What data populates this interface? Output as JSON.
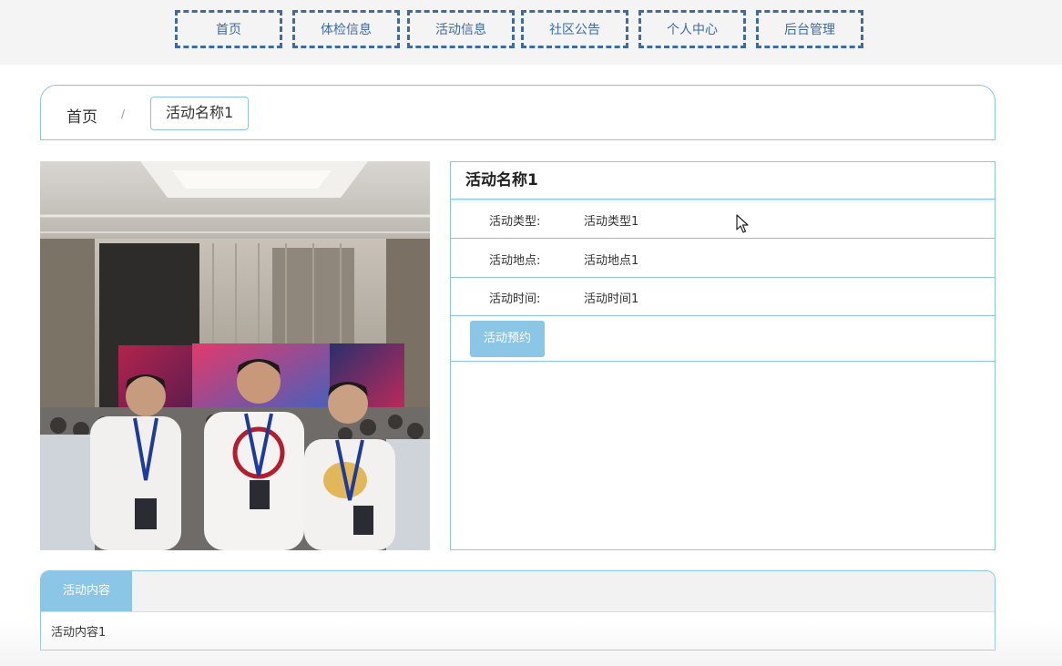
{
  "nav": {
    "items": [
      {
        "label": "首页"
      },
      {
        "label": "体检信息"
      },
      {
        "label": "活动信息"
      },
      {
        "label": "社区公告"
      },
      {
        "label": "个人中心"
      },
      {
        "label": "后台管理"
      }
    ]
  },
  "breadcrumb": {
    "home": "首页",
    "separator": "/",
    "current": "活动名称1"
  },
  "detail": {
    "title": "活动名称1",
    "rows": [
      {
        "label": "活动类型:",
        "value": "活动类型1"
      },
      {
        "label": "活动地点:",
        "value": "活动地点1"
      },
      {
        "label": "活动时间:",
        "value": "活动时间1"
      }
    ],
    "reserve_label": "活动预约"
  },
  "content": {
    "tab_label": "活动内容",
    "body": "活动内容1"
  },
  "colors": {
    "accent": "#8cc6e6",
    "border": "#8ec5e0",
    "nav_dashed": "#3f6aa8"
  }
}
